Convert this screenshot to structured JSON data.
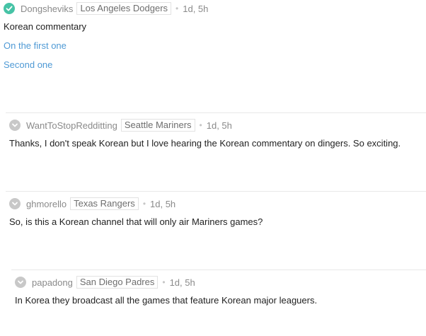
{
  "colors": {
    "vote_active": "#46c3a6",
    "vote_inactive": "#c8c8c8",
    "link": "#4f9ad5",
    "divider": "#e8e8e8"
  },
  "comments": [
    {
      "username": "Dongsheviks",
      "flair": "Los Angeles Dodgers",
      "separator": "•",
      "age": "1d, 5h",
      "vote_icon": "check-icon",
      "body": "Korean commentary",
      "links": [
        "On the first one",
        "Second one"
      ]
    },
    {
      "username": "WantToStopRedditting",
      "flair": "Seattle Mariners",
      "separator": "•",
      "age": "1d, 5h",
      "vote_icon": "chevron-down-icon",
      "body": "Thanks, I don't speak Korean but I love hearing the Korean commentary on dingers. So exciting."
    },
    {
      "username": "ghmorello",
      "flair": "Texas Rangers",
      "separator": "•",
      "age": "1d, 5h",
      "vote_icon": "chevron-down-icon",
      "body": "So, is this a Korean channel that will only air Mariners games?"
    },
    {
      "username": "papadong",
      "flair": "San Diego Padres",
      "separator": "•",
      "age": "1d, 5h",
      "vote_icon": "chevron-down-icon",
      "body": "In Korea they broadcast all the games that feature Korean major leaguers."
    }
  ]
}
